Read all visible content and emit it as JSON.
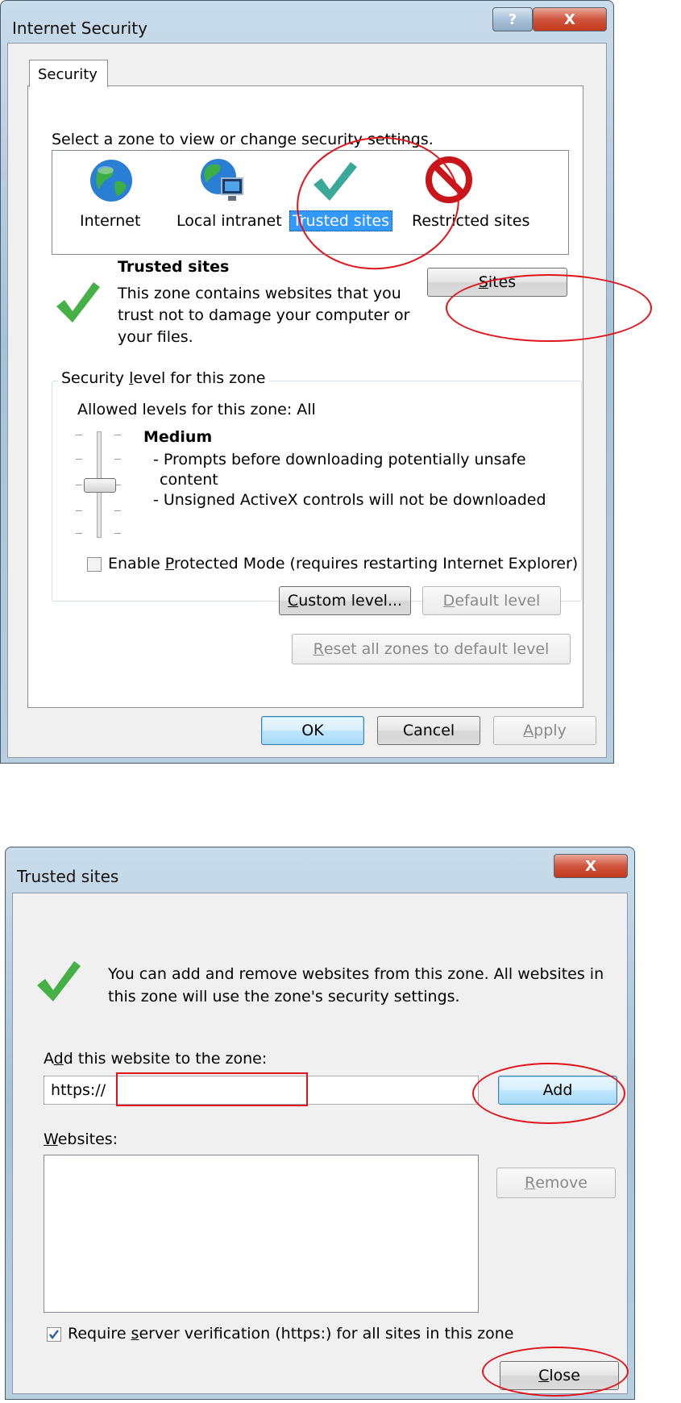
{
  "internet_security": {
    "window_title": "Internet Security",
    "help_glyph": "?",
    "close_glyph": "X",
    "tab_label": "Security",
    "select_zone_text": "Select a zone to view or change security settings.",
    "zones": [
      {
        "label": "Internet",
        "icon": "globe-icon"
      },
      {
        "label": "Local intranet",
        "icon": "network-globe-icon"
      },
      {
        "label": "Trusted sites",
        "icon": "green-check-icon",
        "selected": true
      },
      {
        "label": "Restricted sites",
        "icon": "no-entry-icon"
      }
    ],
    "zone_title": "Trusted sites",
    "zone_desc_lines": [
      "This zone contains websites that you",
      "trust not to damage your computer or",
      "your files."
    ],
    "sites_button": {
      "pre": "",
      "accel": "S",
      "post": "ites"
    },
    "security_level_group": {
      "pre": "Security ",
      "accel": "l",
      "post": "evel for this zone"
    },
    "allowed_levels": "Allowed levels for this zone: All",
    "level_title": "Medium",
    "level_lines": [
      "- Prompts before downloading potentially unsafe",
      "content",
      "- Unsigned ActiveX controls will not be downloaded"
    ],
    "slider_level": "Medium",
    "protected_mode": {
      "pre": "Enable ",
      "accel": "P",
      "post": "rotected Mode (requires restarting Internet Explorer)",
      "checked": false
    },
    "custom_level": {
      "pre": "",
      "accel": "C",
      "post": "ustom level..."
    },
    "default_level": {
      "pre": "",
      "accel": "D",
      "post": "efault level"
    },
    "reset_all": {
      "pre": "",
      "accel": "R",
      "post": "eset all zones to default level"
    },
    "ok_label": "OK",
    "cancel_label": "Cancel",
    "apply": {
      "pre": "",
      "accel": "A",
      "post": "pply"
    }
  },
  "trusted_sites": {
    "window_title": "Trusted sites",
    "close_glyph": "X",
    "info_lines": [
      "You can add and remove websites from this zone. All websites in",
      "this zone will use the zone's security settings."
    ],
    "add_label": {
      "pre": "A",
      "accel": "d",
      "post": "d this website to the zone:"
    },
    "url_value": "https://",
    "add_button": "Add",
    "websites_label": {
      "pre": "",
      "accel": "W",
      "post": "ebsites:"
    },
    "websites": [],
    "remove": {
      "pre": "",
      "accel": "R",
      "post": "emove"
    },
    "require_verification": {
      "pre": "Require ",
      "accel": "s",
      "post": "erver verification (https:) for all sites in this zone",
      "checked": true
    },
    "close": {
      "pre": "",
      "accel": "C",
      "post": "lose"
    }
  },
  "colors": {
    "annotation_red": "#e0141b",
    "selection_blue": "#3399ff",
    "check_green": "#3fae3f"
  }
}
